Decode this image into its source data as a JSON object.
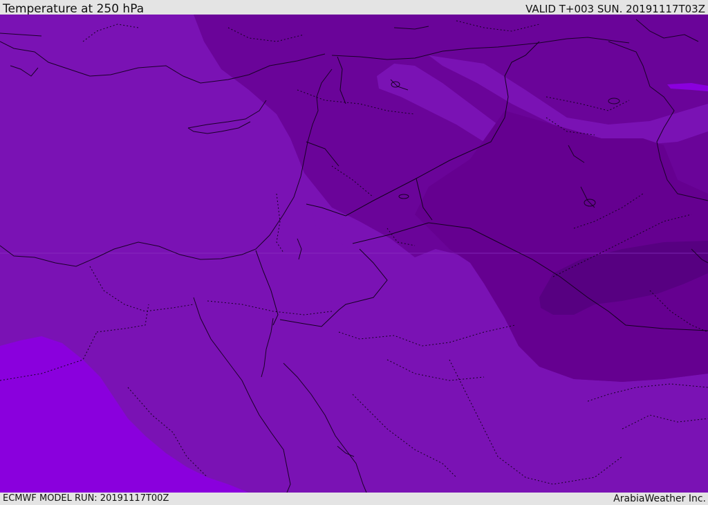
{
  "header": {
    "title": "Temperature at 250 hPa",
    "valid_time": "VALID T+003 SUN. 20191117T03Z"
  },
  "footer": {
    "model_run": "ECMWF MODEL RUN: 20191117T00Z",
    "credit": "ArabiaWeather Inc."
  },
  "map": {
    "layer": "temperature-250hPa",
    "colors": {
      "base": "#7a12b4",
      "cool_band": "#6a0499",
      "colder_band": "#650090",
      "coldest_core": "#570081",
      "warm_region": "#8a00dd",
      "light_streak": "#8318c4",
      "coastline": "#1a0028",
      "border": "#140020"
    }
  }
}
